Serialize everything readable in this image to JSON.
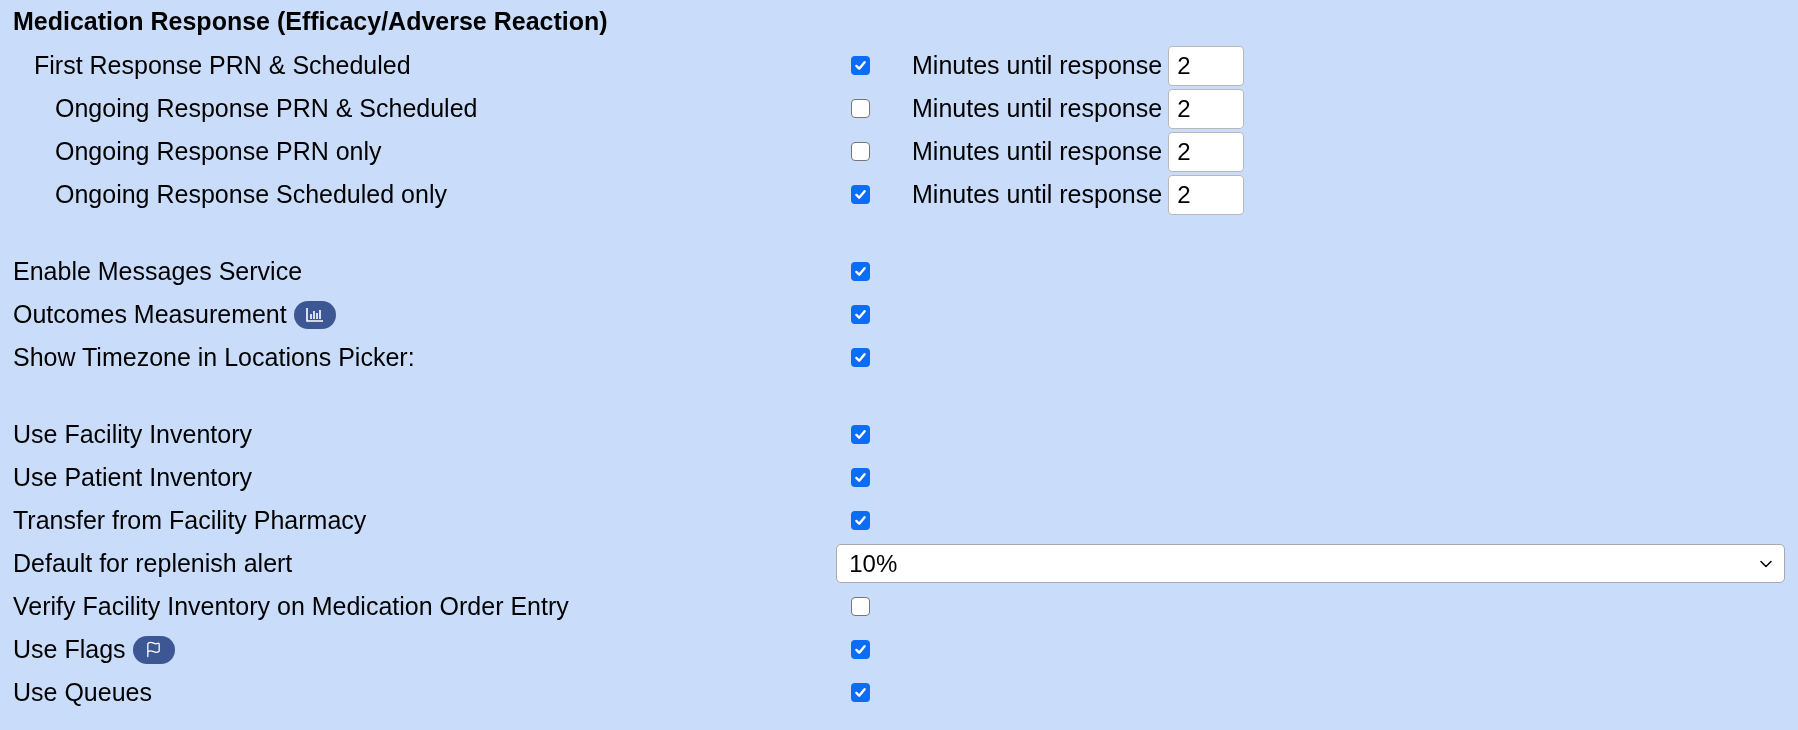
{
  "heading": "Medication Response (Efficacy/Adverse Reaction)",
  "response": {
    "label": "First Response PRN & Scheduled",
    "checked": true,
    "minutes_label": "Minutes until response",
    "minutes": "2",
    "children": [
      {
        "label": "Ongoing Response PRN & Scheduled",
        "checked": false,
        "minutes_label": "Minutes until response",
        "minutes": "2"
      },
      {
        "label": "Ongoing Response PRN only",
        "checked": false,
        "minutes_label": "Minutes until response",
        "minutes": "2"
      },
      {
        "label": "Ongoing Response Scheduled only",
        "checked": true,
        "minutes_label": "Minutes until response",
        "minutes": "2"
      }
    ]
  },
  "groups": [
    [
      {
        "kind": "checkbox",
        "label": "Enable Messages Service",
        "checked": true
      },
      {
        "kind": "checkbox",
        "label": "Outcomes Measurement",
        "badge": {
          "kind": "chart"
        },
        "checked": true
      },
      {
        "kind": "checkbox",
        "label": "Show Timezone in Locations Picker:",
        "checked": true
      }
    ],
    [
      {
        "kind": "checkbox",
        "label": "Use Facility Inventory",
        "checked": true
      },
      {
        "kind": "checkbox",
        "label": "Use Patient Inventory",
        "checked": true
      },
      {
        "kind": "checkbox",
        "label": "Transfer from Facility Pharmacy",
        "checked": true
      },
      {
        "kind": "select",
        "label": "Default for replenish alert",
        "value": "10%"
      },
      {
        "kind": "checkbox",
        "label": "Verify Facility Inventory on Medication Order Entry",
        "checked": false
      },
      {
        "kind": "checkbox",
        "label": "Use Flags",
        "badge": {
          "kind": "flag"
        },
        "checked": true
      },
      {
        "kind": "checkbox",
        "label": "Use Queues",
        "checked": true
      }
    ]
  ]
}
